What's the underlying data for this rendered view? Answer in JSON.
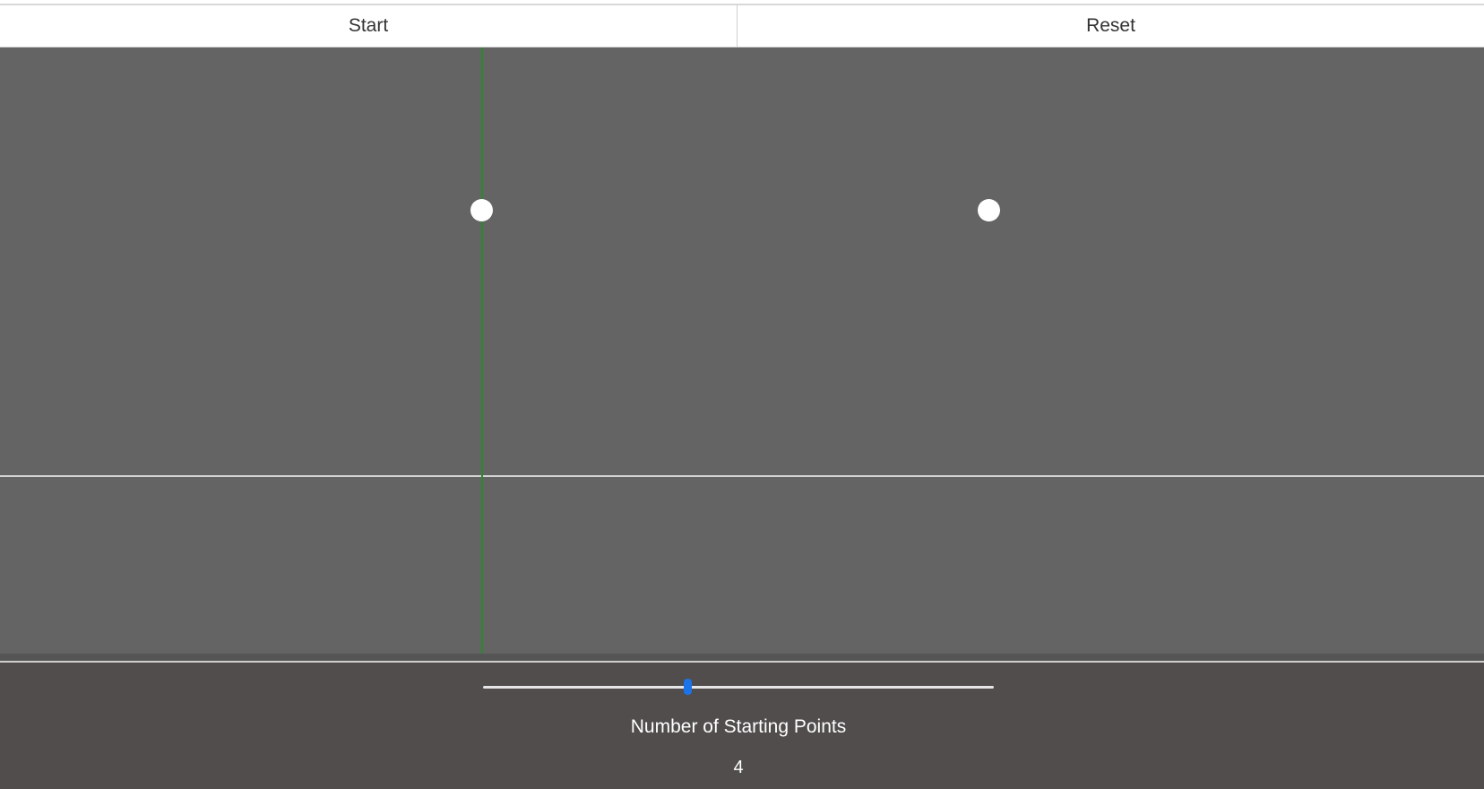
{
  "toolbar": {
    "start_label": "Start",
    "reset_label": "Reset"
  },
  "canvas": {
    "background_color": "#646464",
    "sweep_line_color": "#2a8a2a",
    "point_color": "#ffffff",
    "points_shown": 2
  },
  "controls": {
    "slider_label": "Number of Starting Points",
    "slider_value": "4",
    "slider_fraction": 0.4,
    "thumb_color": "#1a73e8"
  }
}
